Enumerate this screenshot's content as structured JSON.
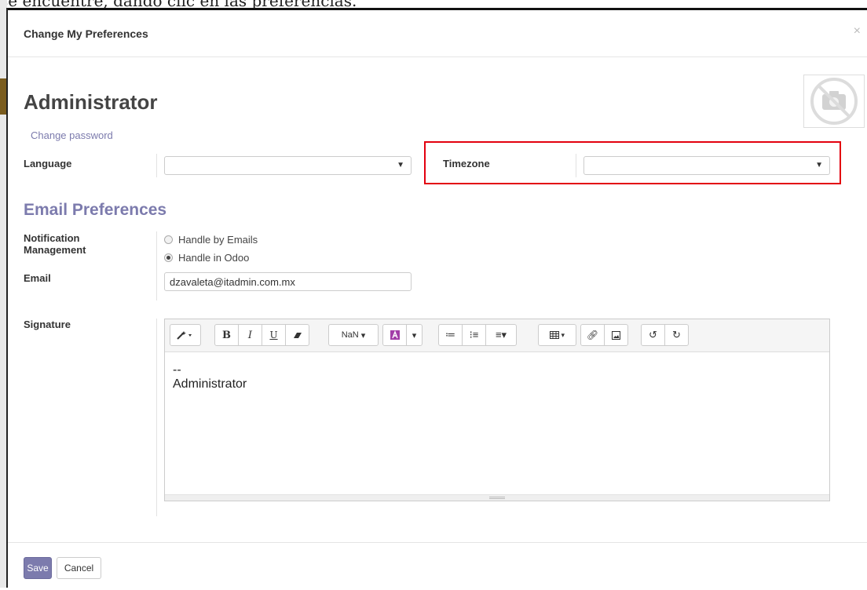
{
  "background_text": "se encuentre, dando clic en las preferencias.",
  "dialog": {
    "title": "Change My Preferences",
    "close_glyph": "×"
  },
  "user": {
    "name": "Administrator",
    "change_password": "Change password",
    "avatar_icon": "camera-slash-icon"
  },
  "fields": {
    "language_label": "Language",
    "language_value": "",
    "timezone_label": "Timezone",
    "timezone_value": ""
  },
  "email_prefs": {
    "section_title": "Email Preferences",
    "notification_label_1": "Notification",
    "notification_label_2": "Management",
    "options": [
      "Handle by Emails",
      "Handle in Odoo"
    ],
    "selected": "Handle in Odoo",
    "email_label": "Email",
    "email_value": "dzavaleta@itadmin.com.mx"
  },
  "signature": {
    "label": "Signature",
    "line1": "--",
    "line2": "Administrator",
    "font_size_label": "NaN"
  },
  "toolbar_icons": [
    "magic-wand-icon",
    "bold-icon",
    "italic-icon",
    "underline-icon",
    "eraser-icon",
    "font-size-dropdown",
    "font-color-icon",
    "color-caret-icon",
    "unordered-list-icon",
    "ordered-list-icon",
    "align-icon",
    "table-icon",
    "link-icon",
    "picture-icon",
    "undo-icon",
    "redo-icon"
  ],
  "footer": {
    "save": "Save",
    "cancel": "Cancel"
  },
  "colors": {
    "accent": "#7c7bad",
    "highlight": "#e3000f"
  }
}
